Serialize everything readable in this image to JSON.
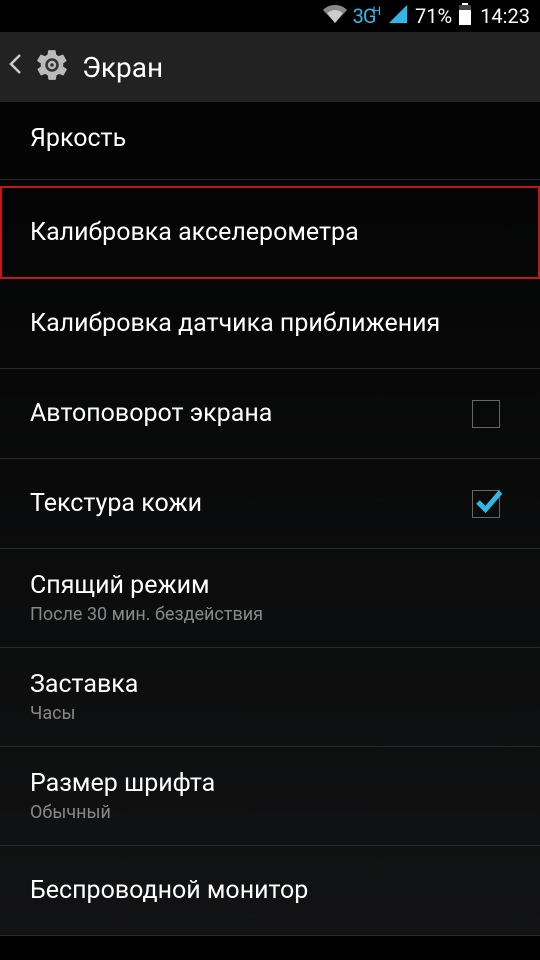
{
  "status": {
    "network_label": "3G",
    "network_suffix": "H",
    "battery_pct": "71%",
    "time": "14:23"
  },
  "header": {
    "title": "Экран"
  },
  "items": {
    "brightness": "Яркость",
    "accel_cal": "Калибровка акселерометра",
    "prox_cal": "Калибровка датчика приближения",
    "autorotate": "Автоповорот экрана",
    "autorotate_checked": false,
    "skin_texture": "Текстура кожи",
    "skin_texture_checked": true,
    "sleep_title": "Спящий режим",
    "sleep_sub": "После 30 мин. бездействия",
    "daydream_title": "Заставка",
    "daydream_sub": "Часы",
    "font_title": "Размер шрифта",
    "font_sub": "Обычный",
    "wireless_display": "Беспроводной монитор"
  }
}
